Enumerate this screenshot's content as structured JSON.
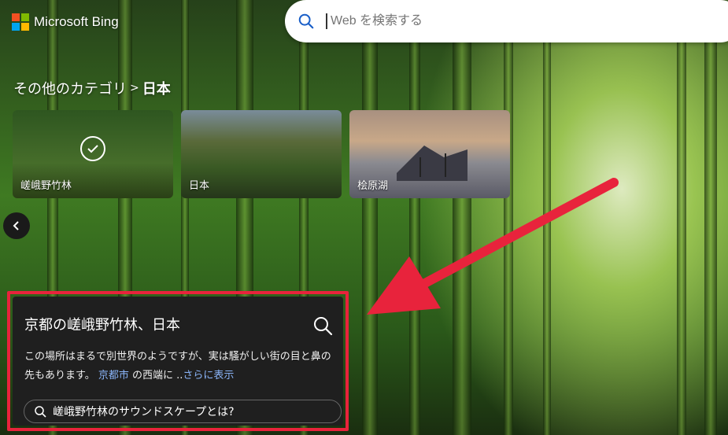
{
  "header": {
    "brand": "Microsoft Bing",
    "search_placeholder": "Web を検索する"
  },
  "breadcrumb": {
    "parent": "その他のカテゴリ",
    "separator": ">",
    "current": "日本"
  },
  "categories": [
    {
      "label": "嵯峨野竹林",
      "selected": true
    },
    {
      "label": "日本",
      "selected": false
    },
    {
      "label": "桧原湖",
      "selected": false
    }
  ],
  "info_card": {
    "title": "京都の嵯峨野竹林、日本",
    "desc_part1": "この場所はまるで別世界のようですが、実は騒がしい街の目と鼻の先もあります。",
    "link": "京都市",
    "desc_part2": " の西端に ..",
    "more": "さらに表示",
    "question": "嵯峨野竹林のサウンドスケープとは?"
  },
  "colors": {
    "highlight_frame": "#e8233c",
    "card_bg": "#1f1f1f",
    "link": "#8ab4f8"
  }
}
